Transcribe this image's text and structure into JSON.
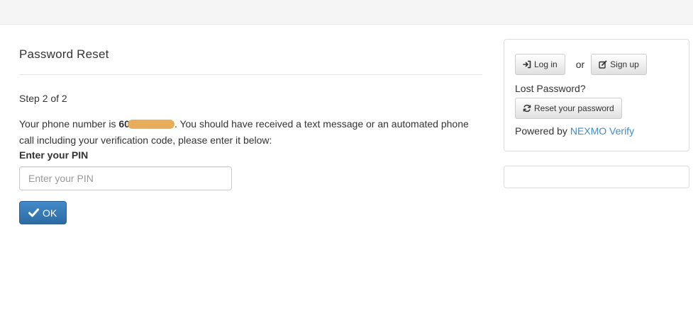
{
  "main": {
    "title": "Password Reset",
    "step": "Step 2 of 2",
    "message_prefix": "Your phone number is ",
    "phone_visible": "60",
    "message_suffix": ". You should have received a text message or an automated phone call including your verification code, please enter it below:",
    "pin_label": "Enter your PIN",
    "pin_placeholder": "Enter your PIN",
    "pin_value": "",
    "ok_label": "OK"
  },
  "sidebar": {
    "login_label": "Log in",
    "or_text": "or",
    "signup_label": "Sign up",
    "lost_password_label": "Lost Password?",
    "reset_label": "Reset your password",
    "powered_by_text": "Powered by ",
    "powered_by_link": "NEXMO Verify"
  },
  "icons": {
    "login": "login-icon",
    "signup": "edit-icon",
    "reset": "refresh-icon",
    "ok": "checkmark-icon"
  },
  "colors": {
    "primary": "#428bca",
    "link": "#428bca",
    "redaction": "#e7ad5a",
    "topbar": "#f5f5f5"
  }
}
